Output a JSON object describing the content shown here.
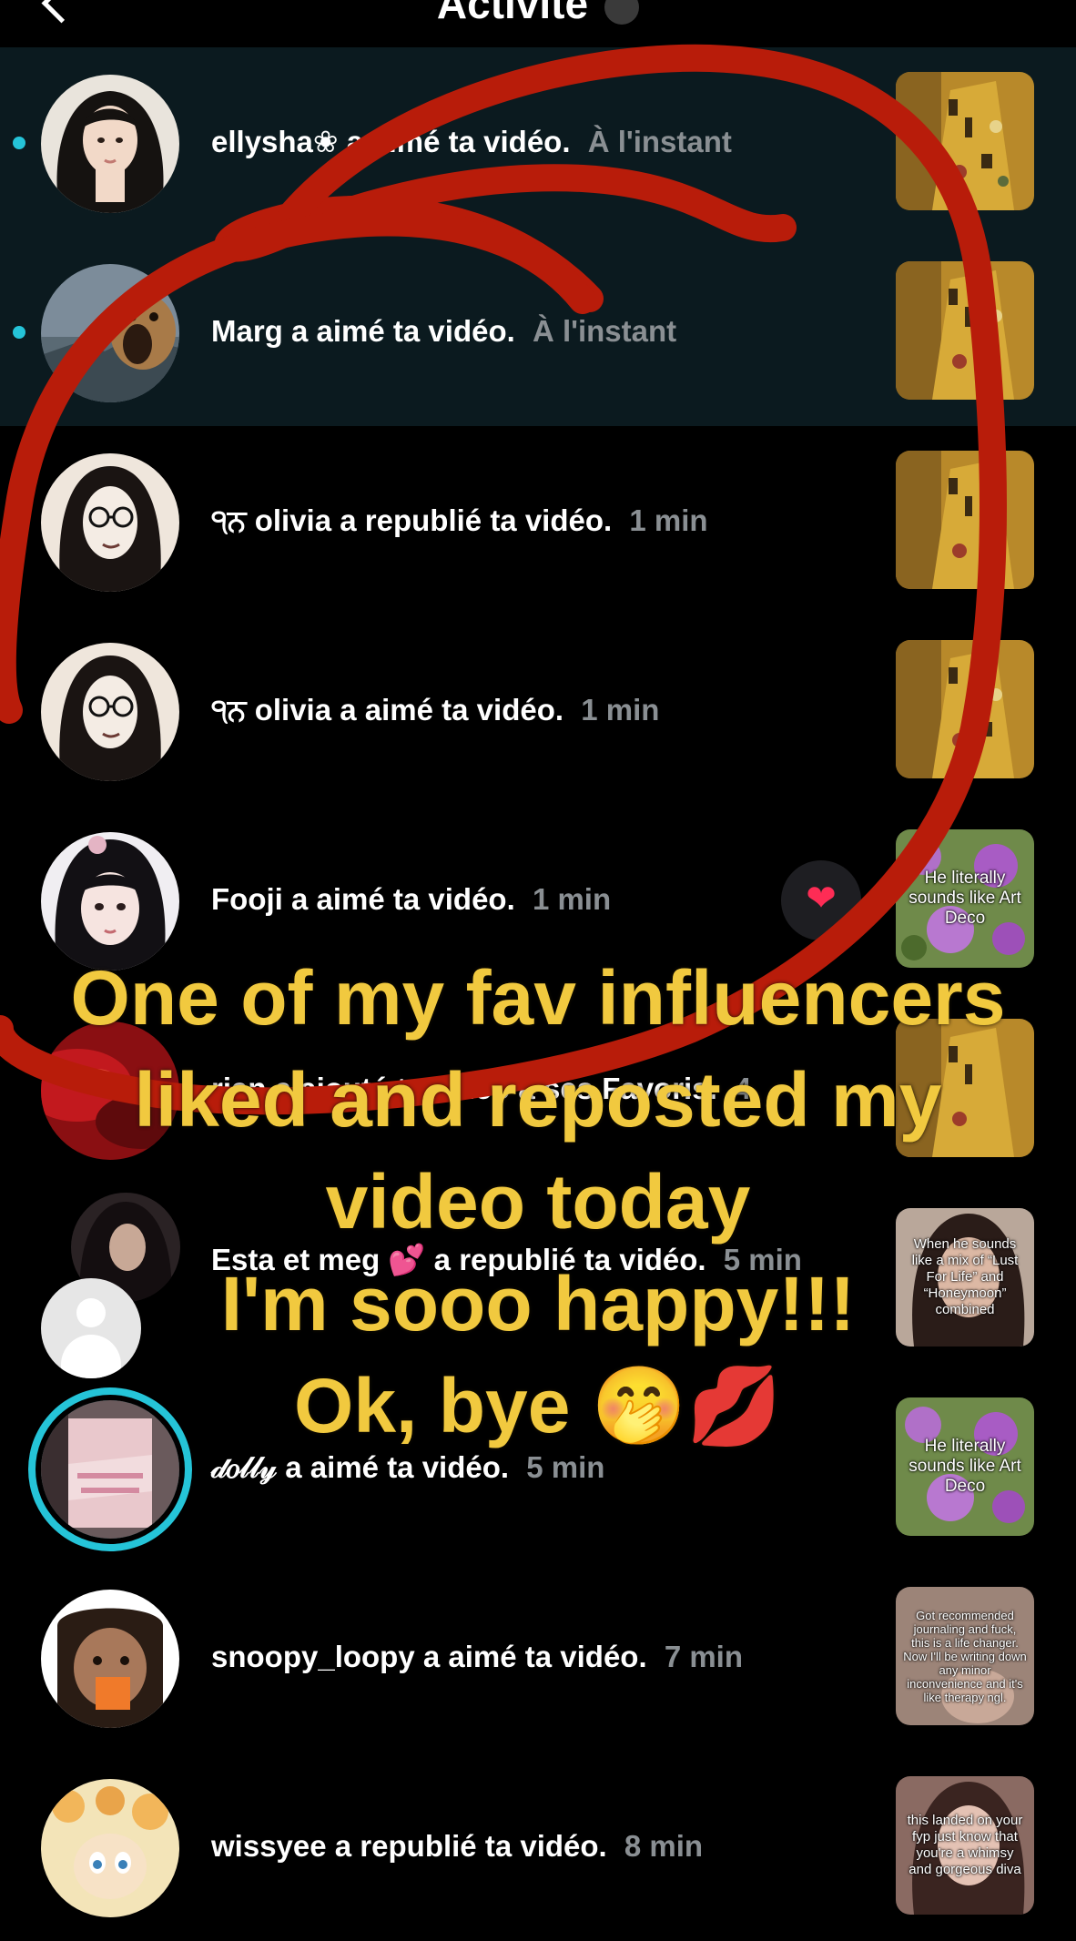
{
  "header": {
    "title": "Activité"
  },
  "notifications": [
    {
      "user": "ellysha❀",
      "action": "a aimé ta vidéo.",
      "time": "À l'instant",
      "unread": true
    },
    {
      "user": "Marg",
      "action": "a aimé ta vidéo.",
      "time": "À l'instant",
      "unread": true
    },
    {
      "user": "੧ਨ olivia",
      "action": "a republié ta vidéo.",
      "time": "1 min",
      "unread": false
    },
    {
      "user": "੧ਨ olivia",
      "action": "a aimé ta vidéo.",
      "time": "1 min",
      "unread": false
    },
    {
      "user": "Fooji",
      "action": "a aimé ta vidéo.",
      "time": "1 min",
      "unread": false
    },
    {
      "user": "rian",
      "action": "a ajouté ta vidéo à ses Favoris.",
      "time": "4",
      "unread": false
    },
    {
      "user": "Esta et meg 💕",
      "action": "a republié ta vidéo.",
      "time": "5 min",
      "unread": false
    },
    {
      "user": "𝒹𝑜𝓁𝓁𝓎",
      "action": "a aimé ta vidéo.",
      "time": "5 min",
      "unread": false
    },
    {
      "user": "snoopy_loopy",
      "action": "a aimé ta vidéo.",
      "time": "7 min",
      "unread": false
    },
    {
      "user": "wissyee",
      "action": "a republié ta vidéo.",
      "time": "8 min",
      "unread": false
    }
  ],
  "thumbnails": {
    "art_deco": "He literally sounds like Art Deco",
    "lust_for_life": "When he sounds like a mix of “Lust For Life” and “Honeymoon” combined",
    "journaling": "Got recommended journaling and fuck, this is a life changer. Now I'll be writing down any minor inconvenience and it's like therapy ngl.",
    "whimsy": "this landed on your fyp just know that you're a whimsy and gorgeous diva"
  },
  "overlay": {
    "line1": "One of my fav influencers",
    "line2": "liked and reposted my",
    "line3": "video today",
    "line4": "I'm sooo happy!!!",
    "line5": "Ok, bye 🤭💋"
  },
  "colors": {
    "background": "#000000",
    "unread_row": "#0b1a1f",
    "unread_dot": "#25c4d8",
    "time_gray": "#8a8f93",
    "overlay_yellow": "#f1c93f",
    "scribble_red": "#b81c0a",
    "like_red": "#fe2c55"
  },
  "icons": {
    "back": "chevron-left-icon",
    "like": "heart-icon"
  }
}
